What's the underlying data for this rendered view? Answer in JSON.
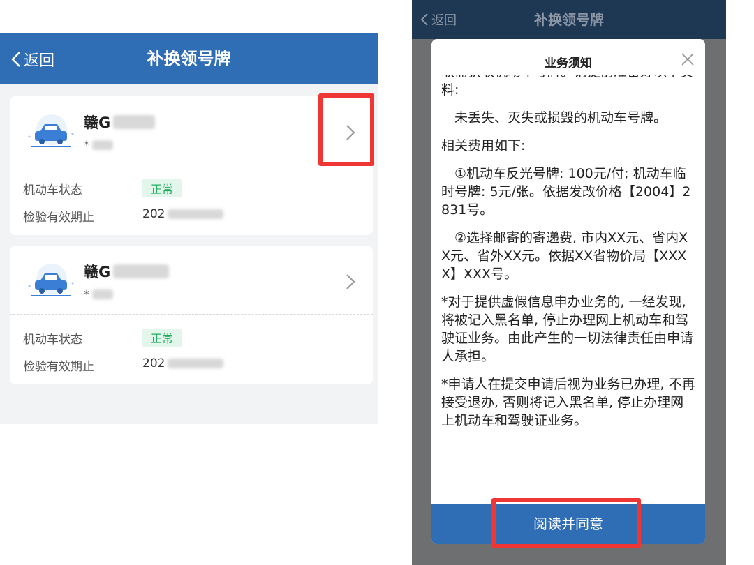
{
  "left_screen": {
    "nav": {
      "back_label": "返回",
      "title": "补换领号牌"
    },
    "vehicles": [
      {
        "plate_prefix": "赣G",
        "status_label": "机动车状态",
        "status_value": "正常",
        "inspection_label": "检验有效期止",
        "inspection_value_prefix": "202"
      },
      {
        "plate_prefix": "赣G",
        "status_label": "机动车状态",
        "status_value": "正常",
        "inspection_label": "检验有效期止",
        "inspection_value_prefix": "202"
      }
    ]
  },
  "right_screen": {
    "nav": {
      "back_label": "返回",
      "title": "补换领号牌"
    },
    "modal": {
      "title": "业务须知",
      "paragraphs": [
        "取需获取机动车号牌。请提前准备好以下资料:",
        "未丢失、灭失或损毁的机动车号牌。",
        "相关费用如下:",
        "①机动车反光号牌: 100元/付; 机动车临时号牌: 5元/张。依据发改价格【2004】2831号。",
        "②选择邮寄的寄递费, 市内XX元、省内XX元、省外XX元。依据XX省物价局【XXXX】XXX号。",
        "*对于提供虚假信息申办业务的, 一经发现, 将被记入黑名单, 停止办理网上机动车和驾驶证业务。由此产生的一切法律责任由申请人承担。",
        "*申请人在提交申请后视为业务已办理, 不再接受退办, 否则将记入黑名单, 停止办理网上机动车和驾驶证业务。"
      ],
      "agree_button": "阅读并同意"
    }
  },
  "colors": {
    "primary": "#2f6db5",
    "highlight": "#f03535",
    "status_green": "#1fae5c"
  },
  "icons": [
    "chevron-left-icon",
    "car-icon",
    "chevron-right-icon",
    "close-icon"
  ]
}
